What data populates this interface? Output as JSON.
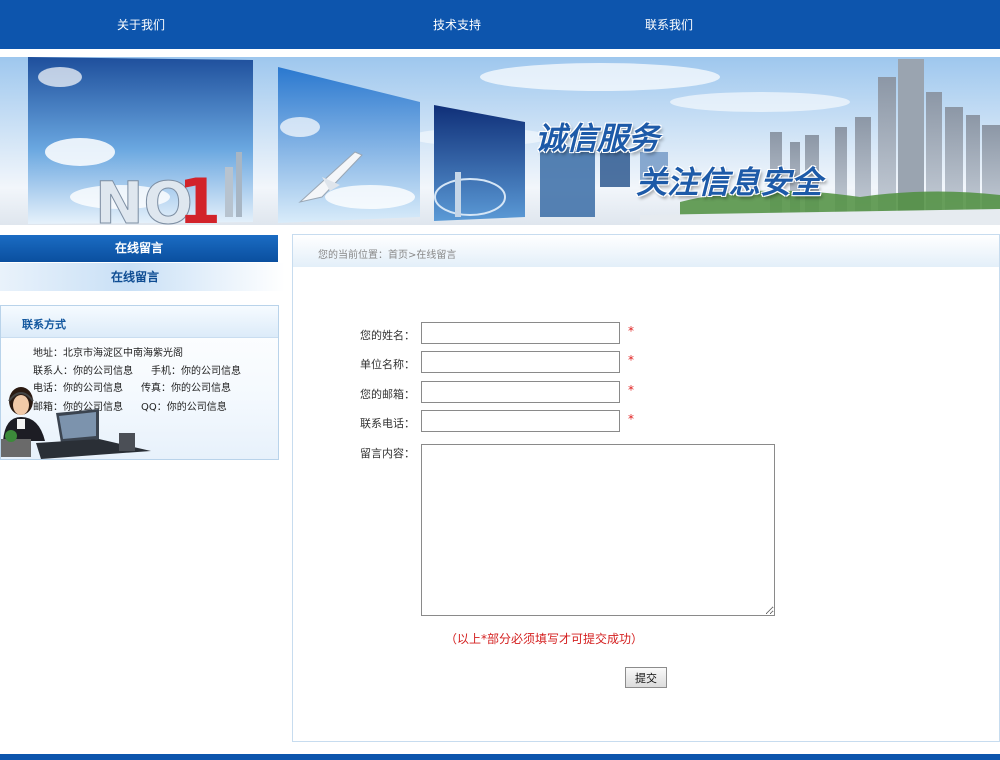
{
  "nav": {
    "items": [
      {
        "label": "关于我们"
      },
      {
        "label": "技术支持"
      },
      {
        "label": "联系我们"
      }
    ]
  },
  "banner": {
    "headline_1": "诚信服务",
    "headline_2": "关注信息安全",
    "panel_text": "NO 1"
  },
  "sidebar": {
    "title": "在线留言",
    "item": "在线留言",
    "contact": {
      "title": "联系方式",
      "address": "地址：北京市海淀区中南海紫光阁",
      "contact_person": "联系人：你的公司信息",
      "mobile": "手机：你的公司信息",
      "phone": "电话：你的公司信息",
      "fax": "传真：你的公司信息",
      "email": "邮箱：你的公司信息",
      "qq": "QQ：你的公司信息"
    }
  },
  "breadcrumb": "您的当前位置：首页>在线留言",
  "form": {
    "name_label": "您的姓名：",
    "name_value": "",
    "company_label": "单位名称：",
    "company_value": "",
    "email_label": "您的邮箱：",
    "email_value": "",
    "phone_label": "联系电话：",
    "phone_value": "",
    "message_label": "留言内容：",
    "message_value": "",
    "required_mark": "*",
    "note": "（以上*部分必须填写才可提交成功）",
    "submit_label": "提交"
  },
  "colors": {
    "brand_blue": "#0d55ad",
    "required_red": "#e02020"
  }
}
